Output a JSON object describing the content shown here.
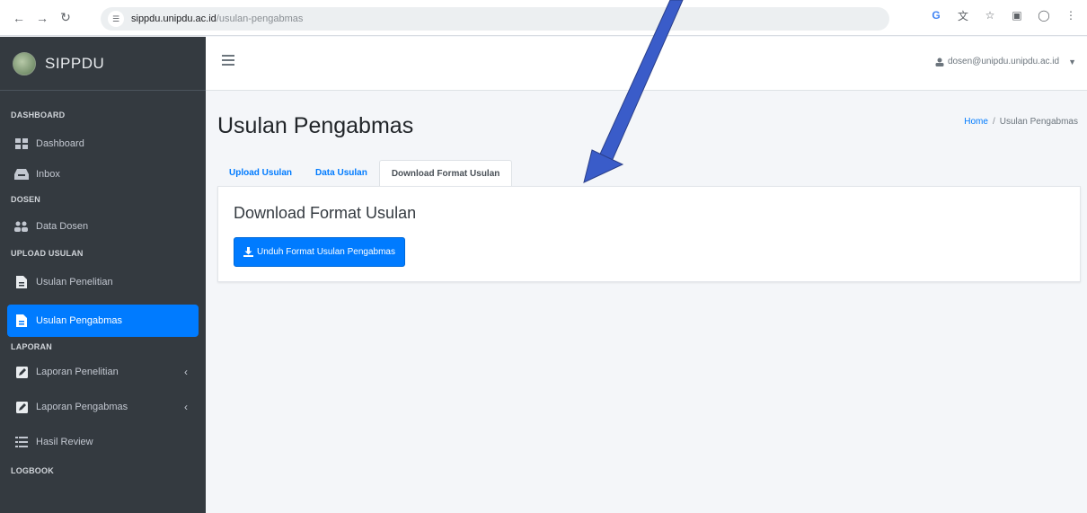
{
  "browser": {
    "url_host": "sippdu.unipdu.ac.id",
    "url_path": "/usulan-pengabmas",
    "translate_label": "G"
  },
  "sidebar": {
    "brand": "SIPPDU",
    "sections": {
      "dashboard": "DASHBOARD",
      "dosen": "DOSEN",
      "upload": "UPLOAD USULAN",
      "laporan": "LAPORAN",
      "logbook": "LOGBOOK"
    },
    "items": {
      "dashboard": "Dashboard",
      "inbox": "Inbox",
      "data_dosen": "Data Dosen",
      "usulan_penelitian": "Usulan Penelitian",
      "usulan_pengabmas": "Usulan Pengabmas",
      "laporan_penelitian": "Laporan Penelitian",
      "laporan_pengabmas": "Laporan Pengabmas",
      "hasil_review": "Hasil Review"
    },
    "active_item": "usulan_pengabmas",
    "accent": "#007bff"
  },
  "header": {
    "user": "dosen@unipdu.unipdu.ac.id"
  },
  "content": {
    "title": "Usulan Pengabmas",
    "breadcrumb": {
      "home": "Home",
      "sep": "/",
      "current": "Usulan Pengabmas"
    },
    "tabs": [
      "Upload Usulan",
      "Data Usulan",
      "Download Format Usulan"
    ],
    "active_tab": 2,
    "card_title": "Download Format Usulan",
    "button_label": "Unduh Format Usulan Pengabmas"
  },
  "colors": {
    "sidebar_bg": "#343a40",
    "primary": "#007bff",
    "annotation_arrow": "#3a5cc9"
  }
}
